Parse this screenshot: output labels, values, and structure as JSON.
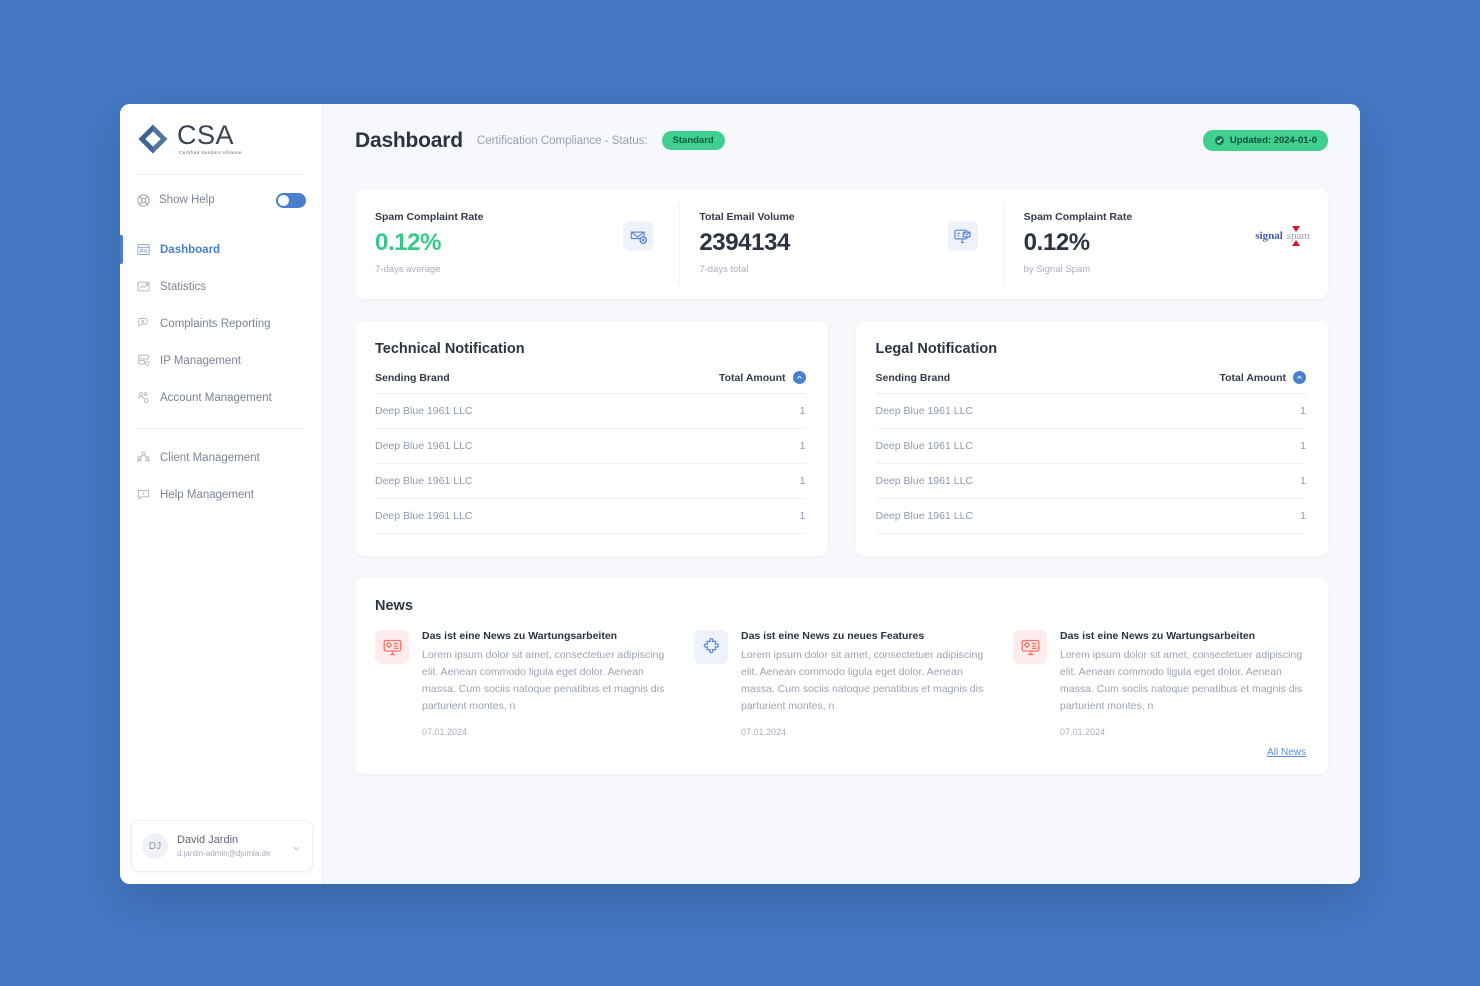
{
  "brand": {
    "logo_title": "CSA",
    "logo_subtitle": "Certified Senders Alliance",
    "logo_icon": "diamond-logo-icon",
    "accent": "#4a7fd0",
    "green": "#3fcf8e",
    "red": "#f4766d"
  },
  "sidebar": {
    "show_help": {
      "label": "Show Help",
      "icon": "life-buoy-icon",
      "toggle_on": true
    },
    "items": [
      {
        "label": "Dashboard",
        "icon": "dashboard-icon",
        "active": true
      },
      {
        "label": "Statistics",
        "icon": "statistics-icon",
        "active": false
      },
      {
        "label": "Complaints Reporting",
        "icon": "complaints-icon",
        "active": false
      },
      {
        "label": "IP Management",
        "icon": "ip-management-icon",
        "active": false
      },
      {
        "label": "Account Management",
        "icon": "account-management-icon",
        "active": false
      }
    ],
    "items_secondary": [
      {
        "label": "Client Management",
        "icon": "client-management-icon",
        "active": false
      },
      {
        "label": "Help Management",
        "icon": "help-management-icon",
        "active": false
      }
    ],
    "user": {
      "initials": "DJ",
      "name": "David Jardin",
      "email": "d.jardin-admin@djumla.de",
      "chevron_icon": "chevron-down-icon"
    }
  },
  "header": {
    "title": "Dashboard",
    "subtitle": "Certification Compliance - Status:",
    "status_badge": "Standard",
    "updated_badge": "Updated: 2024-01-0",
    "updated_icon": "check-circle-icon"
  },
  "stats": [
    {
      "label": "Spam Complaint Rate",
      "value": "0.12%",
      "note": "7-days average",
      "value_color": "green",
      "icon": "mail-blocked-icon"
    },
    {
      "label": "Total Email Volume",
      "value": "2394134",
      "note": "7-days total",
      "value_color": "dark",
      "icon": "monitor-mail-icon"
    },
    {
      "label": "Spam Complaint Rate",
      "value": "0.12%",
      "note": "by Signal Spam",
      "value_color": "dark",
      "icon": "signal-spam-logo"
    }
  ],
  "signal_spam": {
    "word1": "signal",
    "word2": "spam"
  },
  "panels": [
    {
      "title": "Technical Notification",
      "columns": [
        "Sending Brand",
        "Total Amount"
      ],
      "sort_icon": "sort-asc-icon",
      "rows": [
        {
          "brand": "Deep Blue 1961 LLC",
          "amount": "1"
        },
        {
          "brand": "Deep Blue 1961 LLC",
          "amount": "1"
        },
        {
          "brand": "Deep Blue 1961 LLC",
          "amount": "1"
        },
        {
          "brand": "Deep Blue 1961 LLC",
          "amount": "1"
        }
      ]
    },
    {
      "title": "Legal Notification",
      "columns": [
        "Sending Brand",
        "Total Amount"
      ],
      "sort_icon": "sort-asc-icon",
      "rows": [
        {
          "brand": "Deep Blue 1961 LLC",
          "amount": "1"
        },
        {
          "brand": "Deep Blue 1961 LLC",
          "amount": "1"
        },
        {
          "brand": "Deep Blue 1961 LLC",
          "amount": "1"
        },
        {
          "brand": "Deep Blue 1961 LLC",
          "amount": "1"
        }
      ]
    }
  ],
  "news": {
    "title": "News",
    "all_news_label": "All News",
    "items": [
      {
        "heading": "Das ist eine News zu Wartungsarbeiten",
        "text": "Lorem ipsum dolor sit amet, consectetuer adipiscing elit. Aenean commodo ligula eget dolor. Aenean massa. Cum sociis natoque penatibus et magnis dis parturient montes, n",
        "date": "07.01.2024",
        "icon": "monitor-gear-icon",
        "icon_color": "red"
      },
      {
        "heading": "Das ist eine News zu neues Features",
        "text": "Lorem ipsum dolor sit amet, consectetuer adipiscing elit. Aenean commodo ligula eget dolor. Aenean massa. Cum sociis natoque penatibus et magnis dis parturient montes, n",
        "date": "07.01.2024",
        "icon": "puzzle-icon",
        "icon_color": "blue"
      },
      {
        "heading": "Das ist eine News zu Wartungsarbeiten",
        "text": "Lorem ipsum dolor sit amet, consectetuer adipiscing elit. Aenean commodo ligula eget dolor. Aenean massa. Cum sociis natoque penatibus et magnis dis parturient montes, n",
        "date": "07.01.2024",
        "icon": "monitor-gear-icon",
        "icon_color": "red"
      }
    ]
  }
}
